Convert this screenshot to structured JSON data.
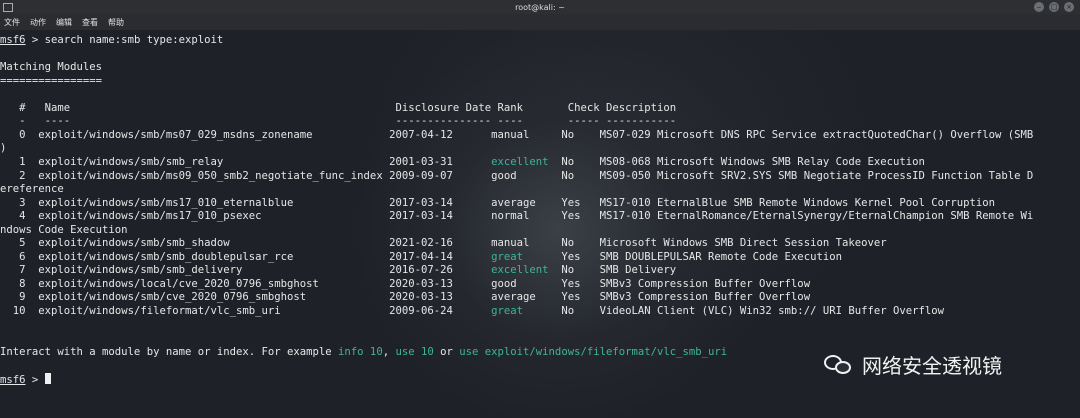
{
  "window": {
    "title": "root@kali: ~",
    "menu": [
      "文件",
      "动作",
      "编辑",
      "查看",
      "帮助"
    ]
  },
  "terminal": {
    "prompt_prefix": "msf6",
    "command": " > search name:smb type:exploit",
    "heading": "Matching Modules",
    "heading_rule": "================",
    "columns": {
      "num": "#",
      "name": "Name",
      "date": "Disclosure Date",
      "rank": "Rank",
      "check": "Check",
      "desc": "Description"
    },
    "dashes": {
      "num": "-",
      "name": "----",
      "date": "---------------",
      "rank": "----",
      "check": "-----",
      "desc": "-----------"
    },
    "rows": [
      {
        "num": "0",
        "name": "exploit/windows/smb/ms07_029_msdns_zonename",
        "date": "2007-04-12",
        "rank": "manual",
        "check": "No",
        "desc": "MS07-029 Microsoft DNS RPC Service extractQuotedChar() Overflow (SMB",
        "wrap": ")"
      },
      {
        "num": "1",
        "name": "exploit/windows/smb/smb_relay",
        "date": "2001-03-31",
        "rank": "excellent",
        "check": "No",
        "desc": "MS08-068 Microsoft Windows SMB Relay Code Execution",
        "wrap": ""
      },
      {
        "num": "2",
        "name": "exploit/windows/smb/ms09_050_smb2_negotiate_func_index",
        "date": "2009-09-07",
        "rank": "good",
        "check": "No",
        "desc": "MS09-050 Microsoft SRV2.SYS SMB Negotiate ProcessID Function Table D",
        "wrap": "ereference"
      },
      {
        "num": "3",
        "name": "exploit/windows/smb/ms17_010_eternalblue",
        "date": "2017-03-14",
        "rank": "average",
        "check": "Yes",
        "desc": "MS17-010 EternalBlue SMB Remote Windows Kernel Pool Corruption",
        "wrap": ""
      },
      {
        "num": "4",
        "name": "exploit/windows/smb/ms17_010_psexec",
        "date": "2017-03-14",
        "rank": "normal",
        "check": "Yes",
        "desc": "MS17-010 EternalRomance/EternalSynergy/EternalChampion SMB Remote Wi",
        "wrap": "ndows Code Execution"
      },
      {
        "num": "5",
        "name": "exploit/windows/smb/smb_shadow",
        "date": "2021-02-16",
        "rank": "manual",
        "check": "No",
        "desc": "Microsoft Windows SMB Direct Session Takeover",
        "wrap": ""
      },
      {
        "num": "6",
        "name": "exploit/windows/smb/smb_doublepulsar_rce",
        "date": "2017-04-14",
        "rank": "great",
        "check": "Yes",
        "desc": "SMB DOUBLEPULSAR Remote Code Execution",
        "wrap": ""
      },
      {
        "num": "7",
        "name": "exploit/windows/smb/smb_delivery",
        "date": "2016-07-26",
        "rank": "excellent",
        "check": "No",
        "desc": "SMB Delivery",
        "wrap": ""
      },
      {
        "num": "8",
        "name": "exploit/windows/local/cve_2020_0796_smbghost",
        "date": "2020-03-13",
        "rank": "good",
        "check": "Yes",
        "desc": "SMBv3 Compression Buffer Overflow",
        "wrap": ""
      },
      {
        "num": "9",
        "name": "exploit/windows/smb/cve_2020_0796_smbghost",
        "date": "2020-03-13",
        "rank": "average",
        "check": "Yes",
        "desc": "SMBv3 Compression Buffer Overflow",
        "wrap": ""
      },
      {
        "num": "10",
        "name": "exploit/windows/fileformat/vlc_smb_uri",
        "date": "2009-06-24",
        "rank": "great",
        "check": "No",
        "desc": "VideoLAN Client (VLC) Win32 smb:// URI Buffer Overflow",
        "wrap": ""
      }
    ],
    "highlight_ranks": [
      "excellent",
      "great"
    ],
    "interact": {
      "p1": "Interact with a module by name or index. For example ",
      "c1": "info 10",
      "p2": ", ",
      "c2": "use 10",
      "p3": " or ",
      "c3": "use exploit/windows/fileformat/vlc_smb_uri"
    },
    "final_prompt_prefix": "msf6",
    "final_prompt_suffix": " > "
  },
  "watermark": {
    "text": "网络安全透视镜",
    "icon": "wechat-icon"
  },
  "colors": {
    "accent_green": "#3db49a",
    "text": "#e6e6e6",
    "background": "#1e2228"
  }
}
